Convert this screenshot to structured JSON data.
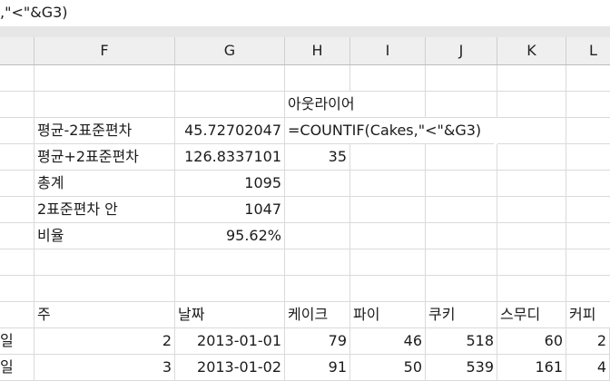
{
  "formula_bar": {
    "text": ",\"<\"&G3)"
  },
  "columns": [
    "F",
    "G",
    "H",
    "I",
    "J",
    "K",
    "L"
  ],
  "cells": {
    "h2": "아웃라이어",
    "f3": "평균-2표준편차",
    "g3": "45.72702047",
    "h3": "=COUNTIF(Cakes,\"<\"&G3)",
    "f4": "평균+2표준편차",
    "g4": "126.8337101",
    "h4": "35",
    "f5": "총계",
    "g5": "1095",
    "f6": "2표준편차 안",
    "g6": "1047",
    "f7": "비율",
    "g7": "95.62%",
    "f10": "주",
    "g10": "날짜",
    "h10": "케이크",
    "i10": "파이",
    "j10": "쿠키",
    "k10": "스무디",
    "l10": "커피",
    "e11": "일",
    "f11": "2",
    "g11": "2013-01-01",
    "h11": "79",
    "i11": "46",
    "j11": "518",
    "k11": "60",
    "l11": "2",
    "e12": "일",
    "f12": "3",
    "g12": "2013-01-02",
    "h12": "91",
    "i12": "50",
    "j12": "539",
    "k12": "161",
    "l12": "4"
  }
}
